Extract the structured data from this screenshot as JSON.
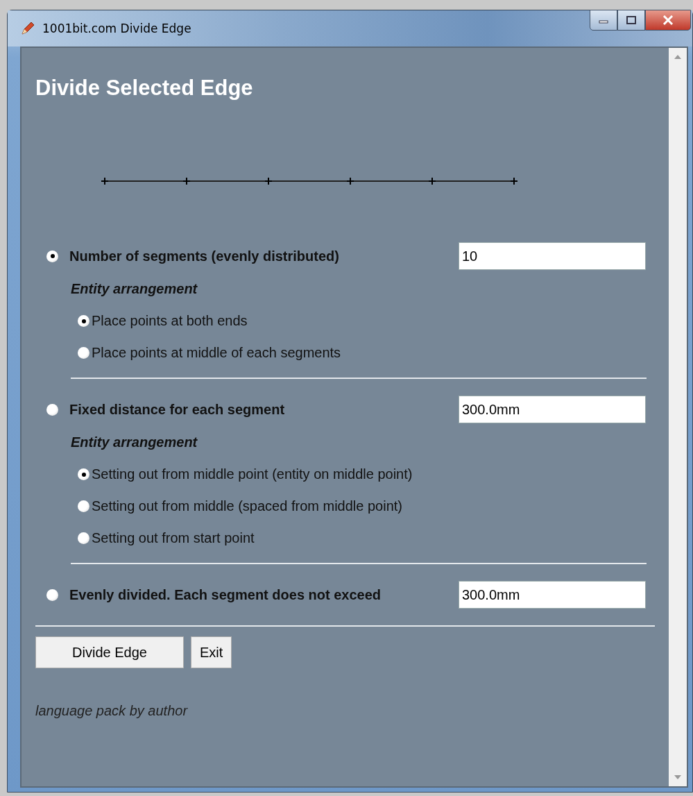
{
  "window": {
    "title": "1001bit.com Divide Edge"
  },
  "heading": "Divide Selected Edge",
  "options": [
    {
      "label": "Number of segments (evenly distributed)",
      "selected": true,
      "value": "10",
      "arrangement_label": "Entity arrangement",
      "arrangement": [
        {
          "label": "Place points at both ends",
          "selected": true
        },
        {
          "label": "Place points at middle of each segments",
          "selected": false
        }
      ]
    },
    {
      "label": "Fixed distance for each segment",
      "selected": false,
      "value": "300.0mm",
      "arrangement_label": "Entity arrangement",
      "arrangement": [
        {
          "label": "Setting out from middle point (entity on middle point)",
          "selected": true
        },
        {
          "label": "Setting out from middle (spaced from middle point)",
          "selected": false
        },
        {
          "label": "Setting out from start point",
          "selected": false
        }
      ]
    },
    {
      "label": "Evenly divided. Each segment does not exceed",
      "selected": false,
      "value": "300.0mm"
    }
  ],
  "buttons": [
    {
      "label": "Divide Edge"
    },
    {
      "label": "Exit"
    }
  ],
  "footer": "language pack by author"
}
